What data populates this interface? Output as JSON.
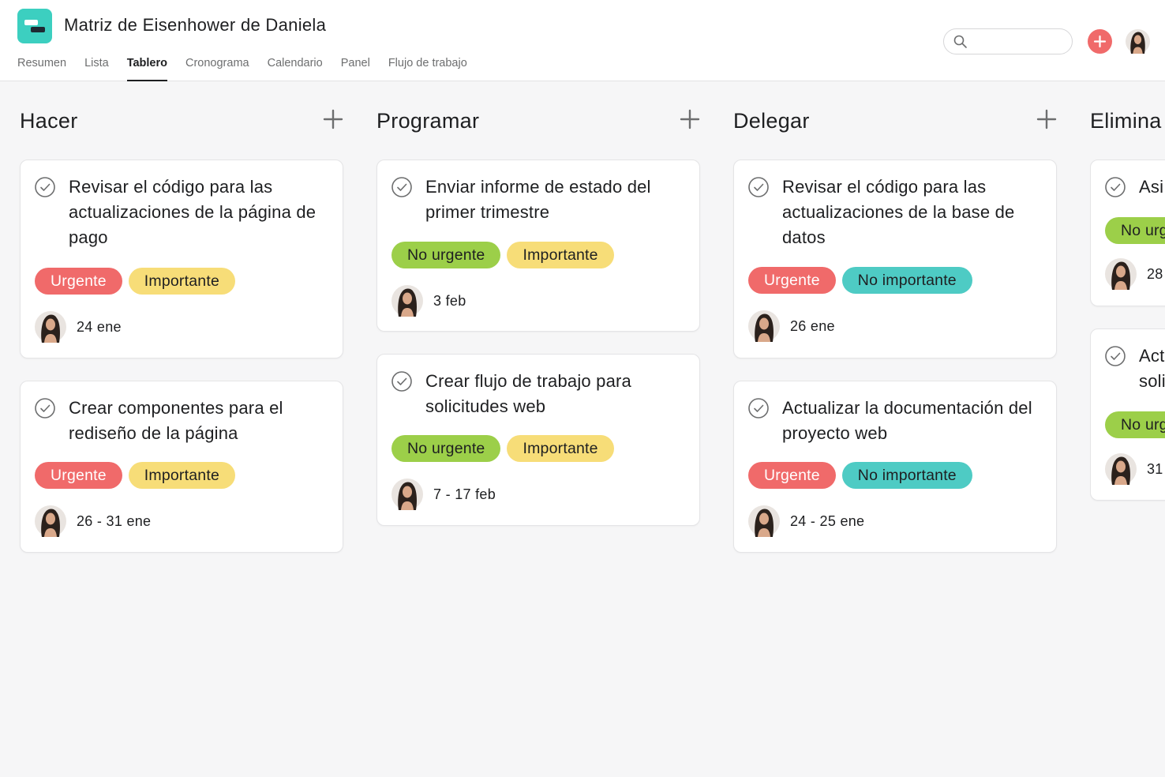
{
  "header": {
    "project_title": "Matriz de Eisenhower de Daniela",
    "tabs": [
      "Resumen",
      "Lista",
      "Tablero",
      "Cronograma",
      "Calendario",
      "Panel",
      "Flujo de trabajo"
    ],
    "active_tab": "Tablero",
    "search": {
      "placeholder": "",
      "value": ""
    }
  },
  "colors": {
    "brand": "#3ccfc0",
    "urgent_red": "#f06a6a",
    "important_yellow": "#f7dd78",
    "not_urgent_green": "#9ccf49",
    "not_important_teal": "#4ecbc4"
  },
  "columns": [
    {
      "title": "Hacer",
      "cards": [
        {
          "title": "Revisar el código para las actualizaciones de la página de pago",
          "tags": [
            "Urgente",
            "Importante"
          ],
          "date": "24 ene"
        },
        {
          "title": "Crear componentes para el rediseño de la página",
          "tags": [
            "Urgente",
            "Importante"
          ],
          "date": "26 - 31 ene"
        }
      ]
    },
    {
      "title": "Programar",
      "cards": [
        {
          "title": "Enviar informe de estado del primer trimestre",
          "tags": [
            "No urgente",
            "Importante"
          ],
          "date": "3 feb"
        },
        {
          "title": "Crear flujo de trabajo para solicitudes web",
          "tags": [
            "No urgente",
            "Importante"
          ],
          "date": "7 - 17 feb"
        }
      ]
    },
    {
      "title": "Delegar",
      "cards": [
        {
          "title": "Revisar el código para las actualizaciones de la base de datos",
          "tags": [
            "Urgente",
            "No importante"
          ],
          "date": "26 ene"
        },
        {
          "title": "Actualizar la documentación del proyecto web",
          "tags": [
            "Urgente",
            "No importante"
          ],
          "date": "24 - 25 ene"
        }
      ]
    },
    {
      "title": "Elimina",
      "cards": [
        {
          "title": "Asi",
          "tags": [
            "No urg"
          ],
          "date": "28"
        },
        {
          "title": "Act soli",
          "tags": [
            "No urg"
          ],
          "date": "31"
        }
      ]
    }
  ]
}
